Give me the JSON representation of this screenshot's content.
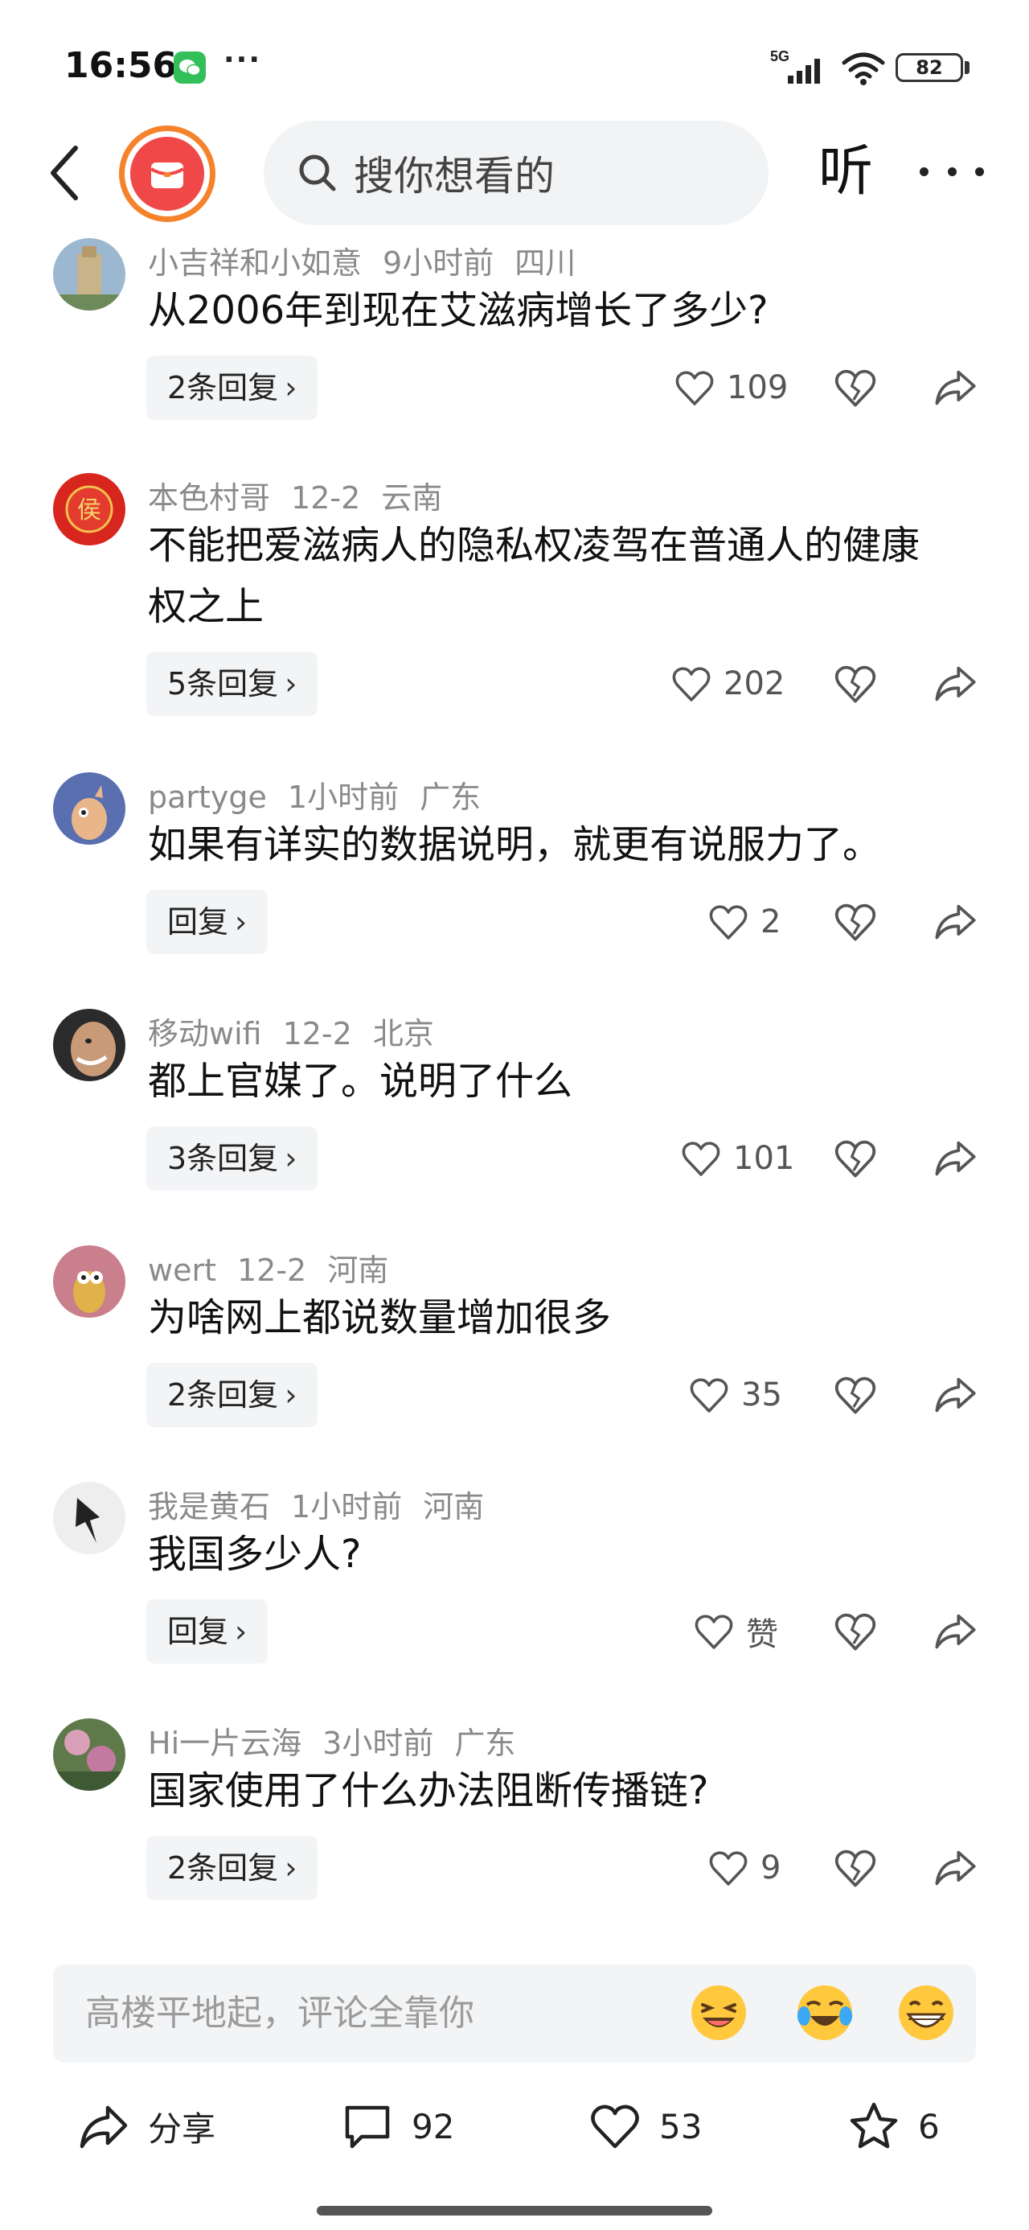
{
  "status_bar": {
    "time": "16:56",
    "dots": "···",
    "network": "5G",
    "battery": "82",
    "icons": [
      "wechat-icon",
      "signal-icon",
      "wifi-icon",
      "battery-icon"
    ]
  },
  "header": {
    "search_placeholder": "搜你想看的",
    "listen_label": "听",
    "icons": [
      "back-icon",
      "app-logo",
      "search-icon",
      "more-icon"
    ]
  },
  "comments": [
    {
      "user": "小吉祥和小如意",
      "time": "9小时前",
      "location": "四川",
      "text": "从2006年到现在艾滋病增长了多少?",
      "reply_label": "2条回复",
      "likes": "109"
    },
    {
      "user": "本色村哥",
      "time": "12-2",
      "location": "云南",
      "text": "不能把爱滋病人的隐私权凌驾在普通人的健康权之上",
      "reply_label": "5条回复",
      "likes": "202"
    },
    {
      "user": "partyge",
      "time": "1小时前",
      "location": "广东",
      "text": "如果有详实的数据说明，就更有说服力了。",
      "reply_label": "回复",
      "likes": "2"
    },
    {
      "user": "移动wifi",
      "time": "12-2",
      "location": "北京",
      "text": "都上官媒了。说明了什么",
      "reply_label": "3条回复",
      "likes": "101"
    },
    {
      "user": "wert",
      "time": "12-2",
      "location": "河南",
      "text": "为啥网上都说数量增加很多",
      "reply_label": "2条回复",
      "likes": "35"
    },
    {
      "user": "我是黄石",
      "time": "1小时前",
      "location": "河南",
      "text": "我国多少人?",
      "reply_label": "回复",
      "likes": "赞"
    },
    {
      "user": "Hi一片云海",
      "time": "3小时前",
      "location": "广东",
      "text": "国家使用了什么办法阻断传播链?",
      "reply_label": "2条回复",
      "likes": "9"
    }
  ],
  "input_bar": {
    "placeholder": "高楼平地起，评论全靠你",
    "emojis": [
      "laughing-emoji-icon",
      "crying-laughing-emoji-icon",
      "grinning-emoji-icon"
    ]
  },
  "bottom_bar": {
    "share_label": "分享",
    "comments_count": "92",
    "likes_count": "53",
    "favorites_count": "6"
  },
  "colors": {
    "accent_orange": "#f5832b",
    "logo_red": "#f04848",
    "wechat_green": "#33c05a",
    "meta_gray": "#8a8a8a",
    "pill_bg": "#f3f4f6"
  }
}
